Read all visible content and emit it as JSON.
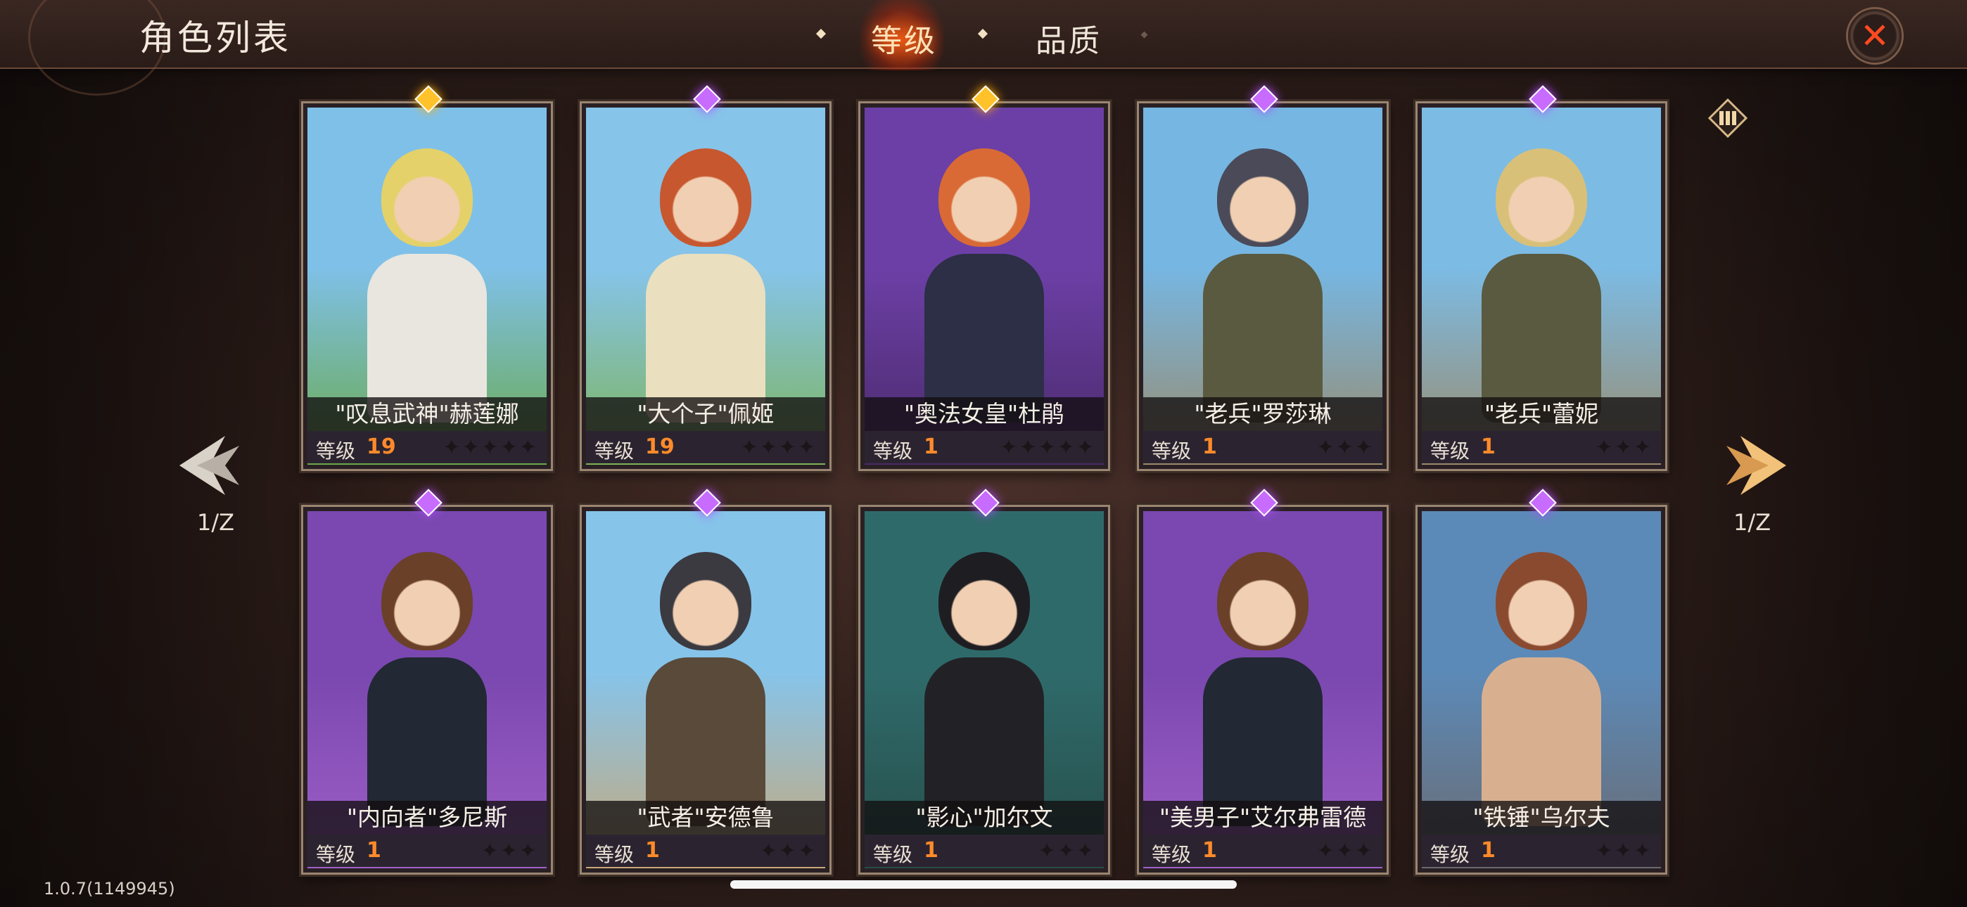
{
  "header": {
    "title": "角色列表"
  },
  "tabs": [
    {
      "label": "等级",
      "active": true
    },
    {
      "label": "品质",
      "active": false
    }
  ],
  "pager": {
    "left": "1/Z",
    "right": "1/Z"
  },
  "level_label": "等级",
  "cards": [
    {
      "name": "\"叹息武神\"赫莲娜",
      "level": "19",
      "gem": "gold",
      "stars": "✦✦✦✦✦",
      "colors": {
        "sky": "#7fc0e8",
        "ground": "#6aa94a",
        "hair": "#e4d16a",
        "outfit": "#e8e6df"
      }
    },
    {
      "name": "\"大个子\"佩姬",
      "level": "19",
      "gem": "purple",
      "stars": "✦✦✦✦",
      "colors": {
        "sky": "#86c4ea",
        "ground": "#7db357",
        "hair": "#c7572e",
        "outfit": "#eadfbf"
      }
    },
    {
      "name": "\"奥法女皇\"杜鹃",
      "level": "1",
      "gem": "gold",
      "stars": "✦✦✦✦✦",
      "colors": {
        "sky": "#6c3fa6",
        "ground": "#4a2a6a",
        "hair": "#d96a35",
        "outfit": "#2c2f45"
      }
    },
    {
      "name": "\"老兵\"罗莎琳",
      "level": "1",
      "gem": "purple",
      "stars": "✦✦✦",
      "colors": {
        "sky": "#76b6e2",
        "ground": "#9a8a6a",
        "hair": "#4a4a58",
        "outfit": "#5a5a40"
      }
    },
    {
      "name": "\"老兵\"蕾妮",
      "level": "1",
      "gem": "purple",
      "stars": "✦✦✦",
      "colors": {
        "sky": "#7cbbe4",
        "ground": "#9a8a6a",
        "hair": "#d8c078",
        "outfit": "#5a5a40"
      }
    },
    {
      "name": "\"内向者\"多尼斯",
      "level": "1",
      "gem": "purple",
      "stars": "✦✦✦",
      "colors": {
        "sky": "#7a48b0",
        "ground": "#a060c8",
        "hair": "#6a4028",
        "outfit": "#222834"
      }
    },
    {
      "name": "\"武者\"安德鲁",
      "level": "1",
      "gem": "purple",
      "stars": "✦✦✦",
      "colors": {
        "sky": "#86c4ea",
        "ground": "#c8a878",
        "hair": "#3a3a40",
        "outfit": "#5a4a3a"
      }
    },
    {
      "name": "\"影心\"加尔文",
      "level": "1",
      "gem": "purple",
      "stars": "✦✦✦",
      "colors": {
        "sky": "#2f6a6a",
        "ground": "#264e4a",
        "hair": "#1e1e22",
        "outfit": "#222226"
      }
    },
    {
      "name": "\"美男子\"艾尔弗雷德",
      "level": "1",
      "gem": "purple",
      "stars": "✦✦✦",
      "colors": {
        "sky": "#7a48b0",
        "ground": "#a060c8",
        "hair": "#6a4028",
        "outfit": "#222834"
      }
    },
    {
      "name": "\"铁锤\"乌尔夫",
      "level": "1",
      "gem": "purple",
      "stars": "✦✦✦",
      "colors": {
        "sky": "#5c8ab8",
        "ground": "#6a6a70",
        "hair": "#8a4a30",
        "outfit": "#d8b090"
      }
    }
  ],
  "version": "1.0.7(1149945)",
  "icons": {
    "close": "close-icon",
    "grid": "grid-view-icon",
    "prev": "prev-arrow-icon",
    "next": "next-arrow-icon"
  }
}
